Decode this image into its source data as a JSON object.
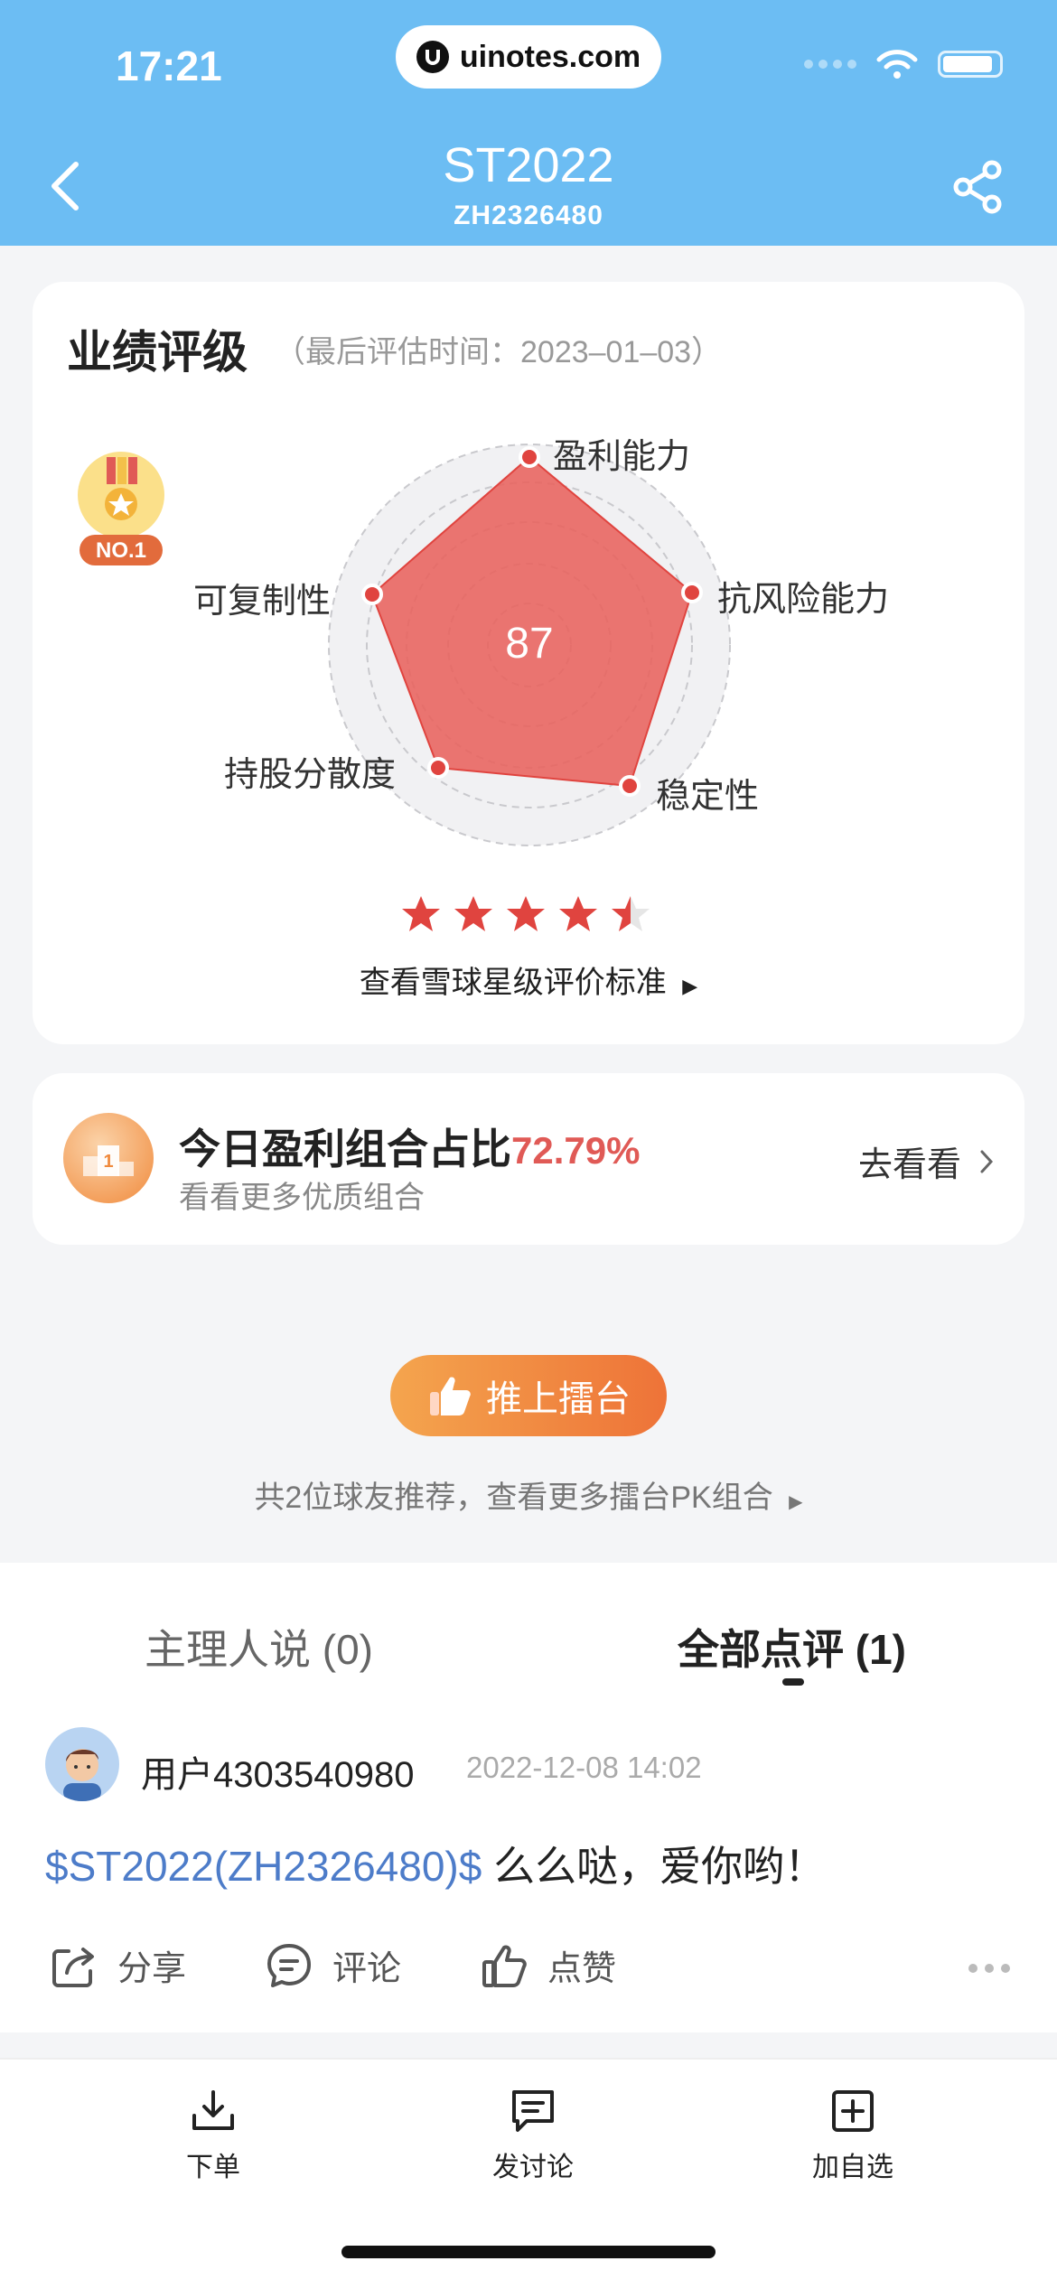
{
  "status_bar": {
    "time": "17:21",
    "url": "uinotes.com"
  },
  "header": {
    "title": "ST2022",
    "subtitle": "ZH2326480"
  },
  "rating": {
    "title": "业绩评级",
    "eval_time": "（最后评估时间：2023–01–03）",
    "medal_label": "NO.1",
    "score": "87",
    "axes": {
      "profit": "盈利能力",
      "risk": "抗风险能力",
      "stability": "稳定性",
      "dispersion": "持股分散度",
      "replicability": "可复制性"
    },
    "star_count": 4.5,
    "star_standard_label": "查看雪球星级评价标准",
    "colors": {
      "fill": "#e8625d",
      "point": "#e0443f"
    }
  },
  "profit_card": {
    "title": "今日盈利组合占比",
    "percent": "72.79%",
    "subtitle": "看看更多优质组合",
    "action": "去看看"
  },
  "recommend": {
    "button": "推上擂台",
    "text": "共2位球友推荐，查看更多擂台PK组合"
  },
  "tabs": {
    "manager": "主理人说 (0)",
    "all": "全部点评 (1)"
  },
  "comment": {
    "user": "用户4303540980",
    "time": "2022-12-08 14:02",
    "link": "$ST2022(ZH2326480)$",
    "text": " 么么哒，爱你哟！",
    "actions": {
      "share": "分享",
      "comment": "评论",
      "like": "点赞"
    }
  },
  "bottom_nav": {
    "order": "下单",
    "discuss": "发讨论",
    "watch": "加自选"
  }
}
